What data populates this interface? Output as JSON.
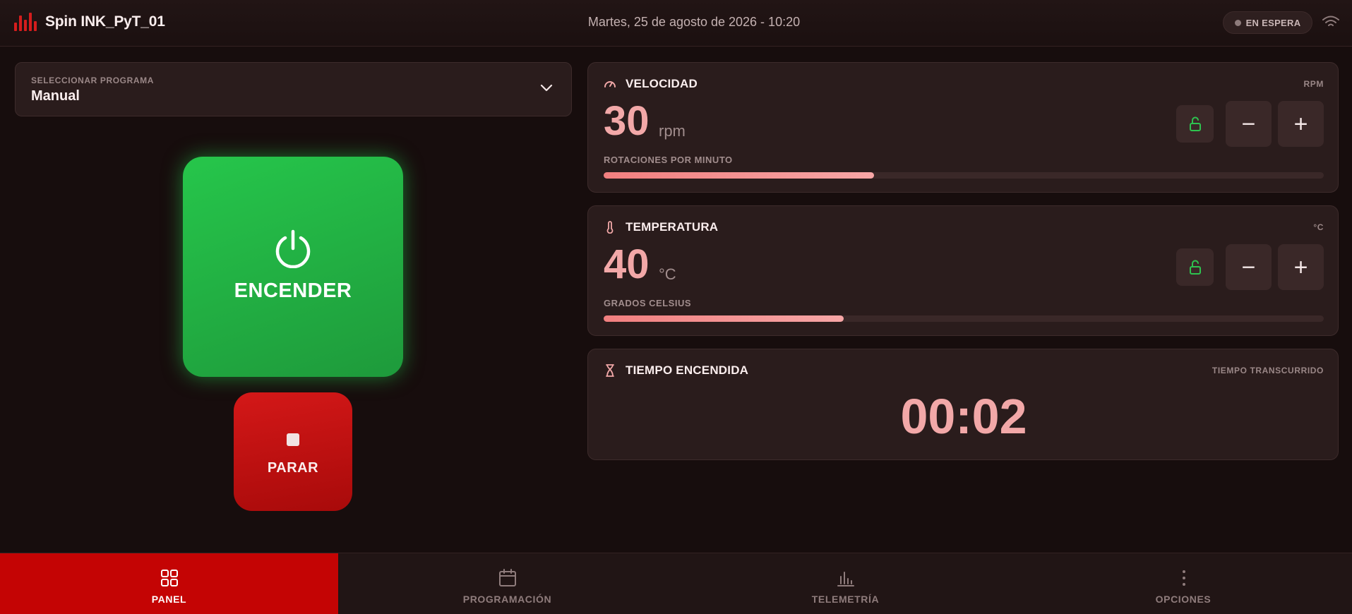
{
  "header": {
    "title": "Spin INK_PyT_01",
    "datetime": "Martes, 25 de agosto de 2026 - 10:20",
    "status": "EN ESPERA",
    "wifi_icon": "wifi-icon",
    "brand_icon": "bar-chart-icon",
    "accent_color": "#d51d1d"
  },
  "program": {
    "caption": "SELECCIONAR PROGRAMA",
    "value": "Manual"
  },
  "controls": {
    "start_label": "ENCENDER",
    "stop_label": "PARAR",
    "start_color": "#22c04a",
    "stop_color": "#c40404"
  },
  "velocity": {
    "title": "VELOCIDAD",
    "unit_tag": "RPM",
    "value": "30",
    "unit": "rpm",
    "sub_label": "ROTACIONES POR MINUTO",
    "progress": 0.375,
    "icon": "gauge-icon"
  },
  "temperature": {
    "title": "TEMPERATURA",
    "unit_tag": "°C",
    "value": "40",
    "unit": "°C",
    "sub_label": "GRADOS CELSIUS",
    "progress": 0.333,
    "icon": "thermometer-icon"
  },
  "timer": {
    "title": "TIEMPO ENCENDIDA",
    "unit_tag": "TIEMPO TRANSCURRIDO",
    "value": "00:02",
    "icon": "hourglass-icon"
  },
  "nav": {
    "items": [
      {
        "label": "PANEL",
        "icon": "grid-icon",
        "active": true
      },
      {
        "label": "PROGRAMACIÓN",
        "icon": "calendar-icon",
        "active": false
      },
      {
        "label": "TELEMETRÍA",
        "icon": "chart-icon",
        "active": false
      },
      {
        "label": "OPCIONES",
        "icon": "more-vertical-icon",
        "active": false
      }
    ]
  }
}
